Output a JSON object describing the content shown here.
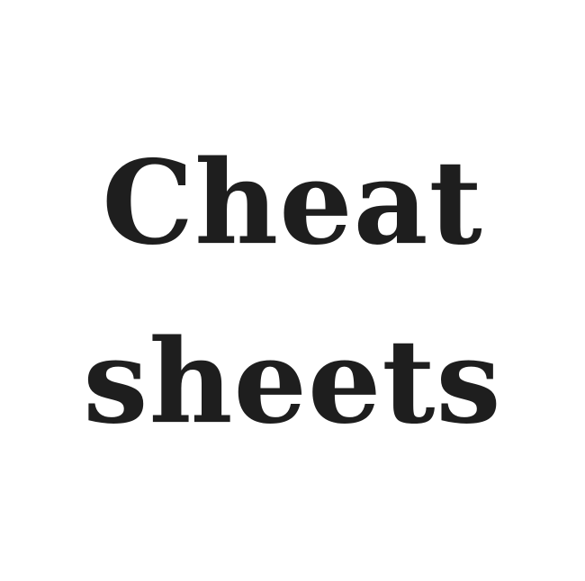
{
  "title": {
    "line1": "Cheat",
    "line2": "sheets"
  },
  "colors": {
    "background": "#ffffff",
    "text": "#1e1e1e"
  }
}
